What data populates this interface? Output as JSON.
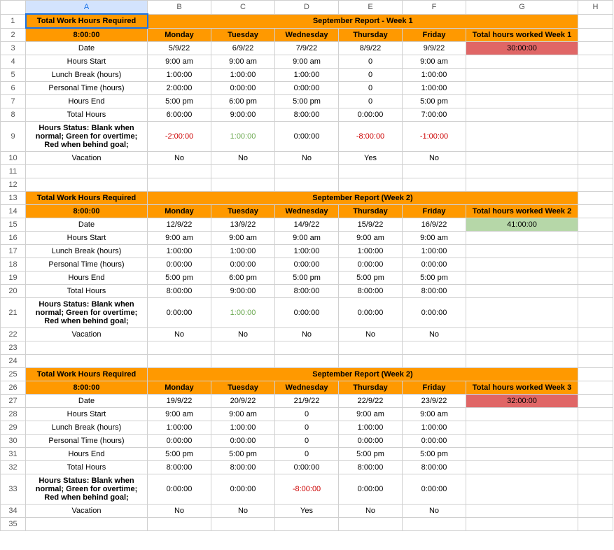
{
  "columns": [
    "A",
    "B",
    "C",
    "D",
    "E",
    "F",
    "G",
    "H"
  ],
  "rows": [
    "1",
    "2",
    "3",
    "4",
    "5",
    "6",
    "7",
    "8",
    "9",
    "10",
    "11",
    "12",
    "13",
    "14",
    "15",
    "16",
    "17",
    "18",
    "19",
    "20",
    "21",
    "22",
    "23",
    "24",
    "25",
    "26",
    "27",
    "28",
    "29",
    "30",
    "31",
    "32",
    "33",
    "34",
    "35"
  ],
  "labels": {
    "twhr": "Total Work Hours Required",
    "eight": "8:00:00",
    "days": [
      "Monday",
      "Tuesday",
      "Wednesday",
      "Thursday",
      "Friday"
    ],
    "date": "Date",
    "hstart": "Hours Start",
    "lunch": "Lunch Break (hours)",
    "personal": "Personal Time (hours)",
    "hend": "Hours End",
    "thours": "Total Hours",
    "status": "Hours Status: Blank when normal; Green for overtime; Red when behind goal;",
    "vacation": "Vacation"
  },
  "week1": {
    "title": "September Report - Week 1",
    "totalLabel": "Total hours worked Week 1",
    "totalValue": "30:00:00",
    "dates": [
      "5/9/22",
      "6/9/22",
      "7/9/22",
      "8/9/22",
      "9/9/22"
    ],
    "start": [
      "9:00 am",
      "9:00 am",
      "9:00 am",
      "0",
      "9:00 am"
    ],
    "lunch": [
      "1:00:00",
      "1:00:00",
      "1:00:00",
      "0",
      "1:00:00"
    ],
    "personal": [
      "2:00:00",
      "0:00:00",
      "0:00:00",
      "0",
      "1:00:00"
    ],
    "end": [
      "5:00 pm",
      "6:00 pm",
      "5:00 pm",
      "0",
      "5:00 pm"
    ],
    "total": [
      "6:00:00",
      "9:00:00",
      "8:00:00",
      "0:00:00",
      "7:00:00"
    ],
    "status": [
      "-2:00:00",
      "1:00:00",
      "0:00:00",
      "-8:00:00",
      "-1:00:00"
    ],
    "statusColor": [
      "red",
      "green",
      "",
      "red",
      "red"
    ],
    "vacation": [
      "No",
      "No",
      "No",
      "Yes",
      "No"
    ]
  },
  "week2": {
    "title": "September Report (Week 2)",
    "totalLabel": "Total hours worked Week 2",
    "totalValue": "41:00:00",
    "dates": [
      "12/9/22",
      "13/9/22",
      "14/9/22",
      "15/9/22",
      "16/9/22"
    ],
    "start": [
      "9:00 am",
      "9:00 am",
      "9:00 am",
      "9:00 am",
      "9:00 am"
    ],
    "lunch": [
      "1:00:00",
      "1:00:00",
      "1:00:00",
      "1:00:00",
      "1:00:00"
    ],
    "personal": [
      "0:00:00",
      "0:00:00",
      "0:00:00",
      "0:00:00",
      "0:00:00"
    ],
    "end": [
      "5:00 pm",
      "6:00 pm",
      "5:00 pm",
      "5:00 pm",
      "5:00 pm"
    ],
    "total": [
      "8:00:00",
      "9:00:00",
      "8:00:00",
      "8:00:00",
      "8:00:00"
    ],
    "status": [
      "0:00:00",
      "1:00:00",
      "0:00:00",
      "0:00:00",
      "0:00:00"
    ],
    "statusColor": [
      "",
      "green",
      "",
      "",
      ""
    ],
    "vacation": [
      "No",
      "No",
      "No",
      "No",
      "No"
    ]
  },
  "week3": {
    "title": "September Report (Week 2)",
    "totalLabel": "Total hours worked Week 3",
    "totalValue": "32:00:00",
    "dates": [
      "19/9/22",
      "20/9/22",
      "21/9/22",
      "22/9/22",
      "23/9/22"
    ],
    "start": [
      "9:00 am",
      "9:00 am",
      "0",
      "9:00 am",
      "9:00 am"
    ],
    "lunch": [
      "1:00:00",
      "1:00:00",
      "0",
      "1:00:00",
      "1:00:00"
    ],
    "personal": [
      "0:00:00",
      "0:00:00",
      "0",
      "0:00:00",
      "0:00:00"
    ],
    "end": [
      "5:00 pm",
      "5:00 pm",
      "0",
      "5:00 pm",
      "5:00 pm"
    ],
    "total": [
      "8:00:00",
      "8:00:00",
      "0:00:00",
      "8:00:00",
      "8:00:00"
    ],
    "status": [
      "0:00:00",
      "0:00:00",
      "-8:00:00",
      "0:00:00",
      "0:00:00"
    ],
    "statusColor": [
      "",
      "",
      "red",
      "",
      ""
    ],
    "vacation": [
      "No",
      "No",
      "Yes",
      "No",
      "No"
    ]
  },
  "chart_data": {
    "type": "table",
    "title": "Weekly Work Hours — September Report",
    "required_hours_per_day": "8:00:00",
    "weeks": [
      {
        "name": "Week 1",
        "total": "30:00:00",
        "days": {
          "Mon": "6:00:00",
          "Tue": "9:00:00",
          "Wed": "8:00:00",
          "Thu": "0:00:00",
          "Fri": "7:00:00"
        }
      },
      {
        "name": "Week 2",
        "total": "41:00:00",
        "days": {
          "Mon": "8:00:00",
          "Tue": "9:00:00",
          "Wed": "8:00:00",
          "Thu": "8:00:00",
          "Fri": "8:00:00"
        }
      },
      {
        "name": "Week 3",
        "total": "32:00:00",
        "days": {
          "Mon": "8:00:00",
          "Tue": "8:00:00",
          "Wed": "0:00:00",
          "Thu": "8:00:00",
          "Fri": "8:00:00"
        }
      }
    ]
  }
}
